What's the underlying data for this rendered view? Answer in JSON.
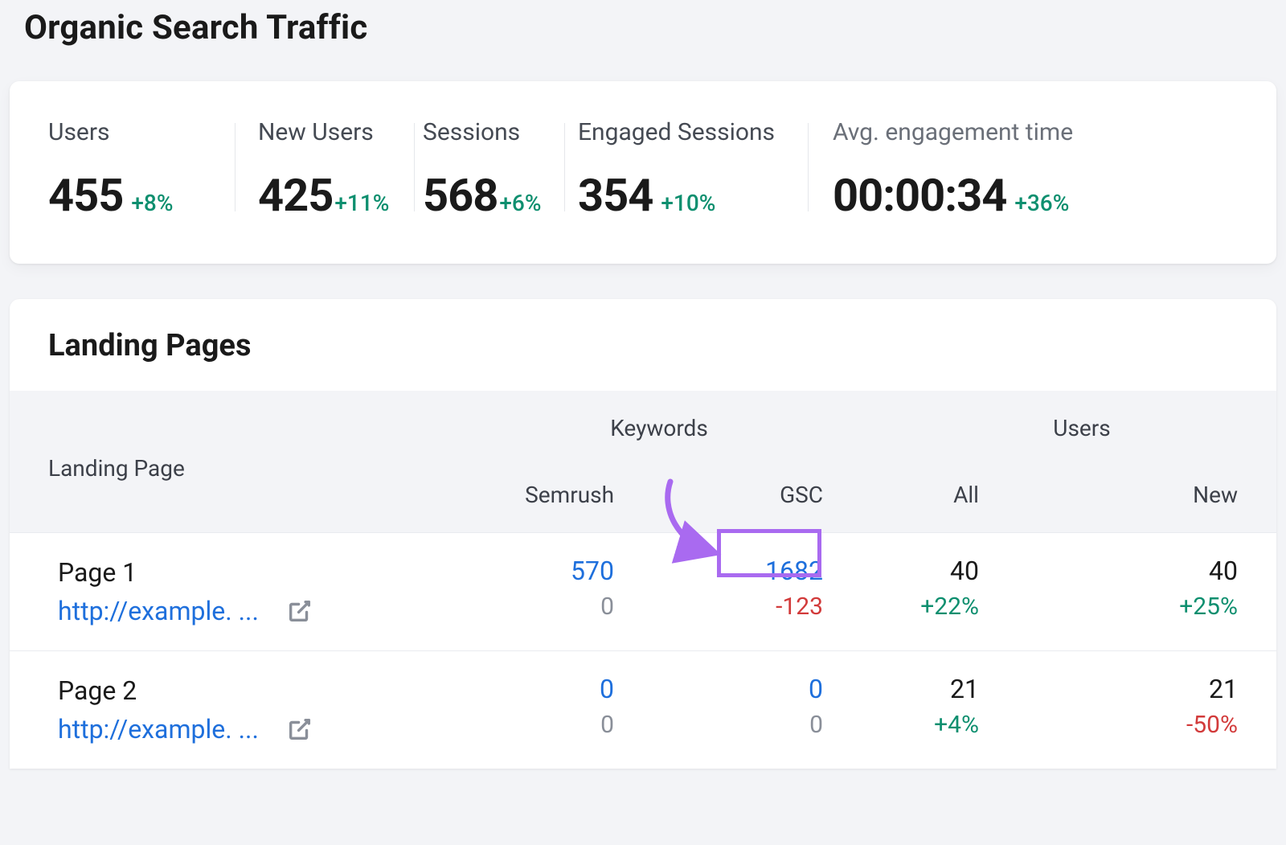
{
  "title": "Organic Search Traffic",
  "stats": {
    "users": {
      "label": "Users",
      "value": "455",
      "change": "+8%"
    },
    "newUsers": {
      "label": "New Users",
      "value": "425",
      "change": "+11%"
    },
    "sessions": {
      "label": "Sessions",
      "value": "568",
      "change": "+6%"
    },
    "engaged": {
      "label": "Engaged Sessions",
      "value": "354",
      "change": "+10%"
    },
    "avg": {
      "label": "Avg. engagement time",
      "value": "00:00:34",
      "change": "+36%"
    }
  },
  "landing": {
    "title": "Landing Pages",
    "headers": {
      "page": "Landing Page",
      "keywords": "Keywords",
      "users": "Users",
      "semrush": "Semrush",
      "gsc": "GSC",
      "all": "All",
      "new": "New"
    },
    "rows": [
      {
        "name": "Page 1",
        "url": "http://example. ...",
        "semrush": {
          "main": "570",
          "sub": "0"
        },
        "gsc": {
          "main": "1682",
          "sub": "-123",
          "highlight": true
        },
        "all": {
          "main": "40",
          "sub": "+22%"
        },
        "new": {
          "main": "40",
          "sub": "+25%"
        }
      },
      {
        "name": "Page 2",
        "url": "http://example. ...",
        "semrush": {
          "main": "0",
          "sub": "0"
        },
        "gsc": {
          "main": "0",
          "sub": "0"
        },
        "all": {
          "main": "21",
          "sub": "+4%"
        },
        "new": {
          "main": "21",
          "sub": "-50%"
        }
      }
    ]
  },
  "colors": {
    "positive": "#0e8f6f",
    "negative": "#d23b3b",
    "link": "#1e6fdc",
    "muted": "#8a8f99",
    "annotation": "#a96af0"
  }
}
